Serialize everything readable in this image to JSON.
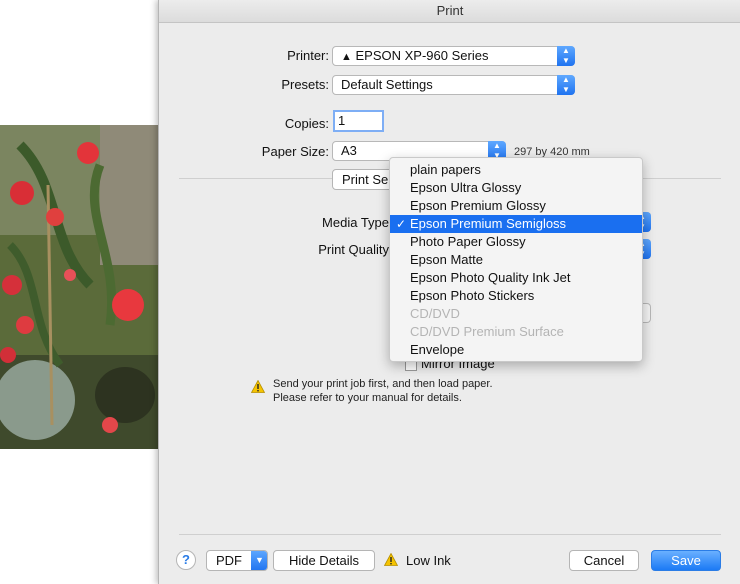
{
  "window": {
    "title": "Print"
  },
  "printer": {
    "label": "Printer:",
    "value": "EPSON XP-960 Series"
  },
  "presets": {
    "label": "Presets:",
    "value": "Default Settings"
  },
  "copies": {
    "label": "Copies:",
    "value": "1"
  },
  "paper_size": {
    "label": "Paper Size:",
    "value": "A3",
    "dimensions": "297 by 420 mm"
  },
  "print_settings_button": {
    "label": "Print Se"
  },
  "media_type": {
    "label": "Media Type"
  },
  "print_quality": {
    "label": "Print Quality"
  },
  "mirror_image": {
    "label": "Mirror Image"
  },
  "media_menu": {
    "items": [
      {
        "label": "plain papers"
      },
      {
        "label": "Epson Ultra Glossy"
      },
      {
        "label": "Epson Premium Glossy"
      },
      {
        "label": "Epson Premium Semigloss",
        "selected": true,
        "check": "✓"
      },
      {
        "label": "Photo Paper Glossy"
      },
      {
        "label": "Epson Matte"
      },
      {
        "label": "Epson Photo Quality Ink Jet"
      },
      {
        "label": "Epson Photo Stickers"
      },
      {
        "label": "CD/DVD",
        "disabled": true
      },
      {
        "label": "CD/DVD Premium Surface",
        "disabled": true
      },
      {
        "label": "Envelope"
      }
    ]
  },
  "notice": {
    "line1": "Send your print job first, and then load paper.",
    "line2": "Please refer to your manual for details."
  },
  "footer": {
    "help": "?",
    "pdf": "PDF",
    "hide_details": "Hide Details",
    "ink_status": "Low Ink",
    "cancel": "Cancel",
    "save": "Save"
  },
  "colors": {
    "accent": "#1a6ff0",
    "warning": "#f5c300"
  },
  "icons": [
    "warning-icon",
    "chevron-updown-icon",
    "chevron-down-icon",
    "checkmark-icon",
    "help-icon"
  ]
}
